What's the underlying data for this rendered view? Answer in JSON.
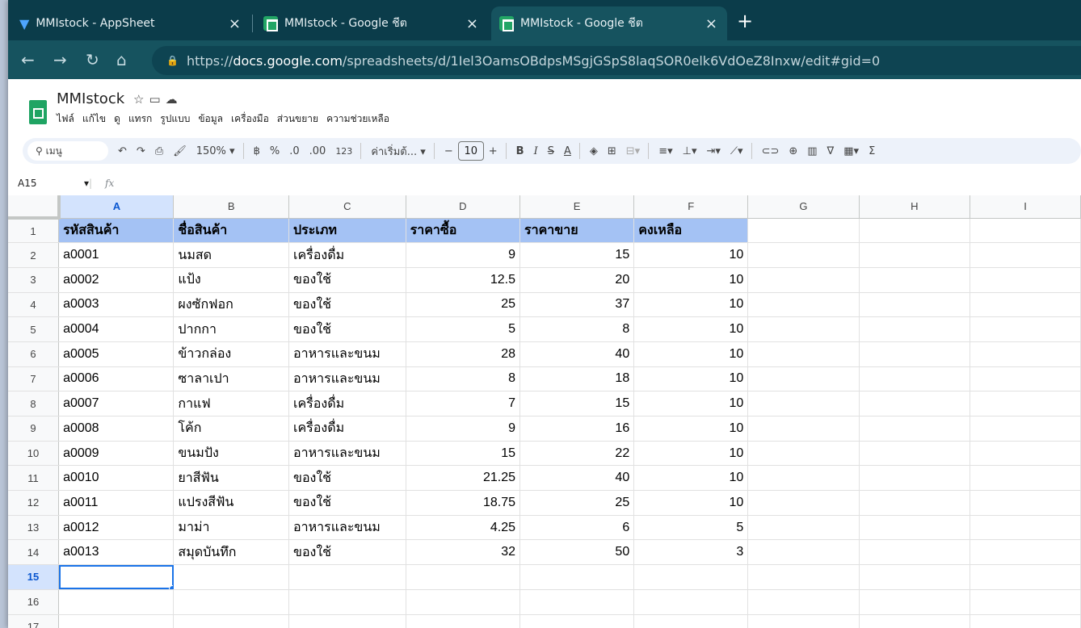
{
  "browser": {
    "tabs": [
      {
        "title": "MMIstock - AppSheet",
        "active": false
      },
      {
        "title": "MMIstock - Google ชีต",
        "active": false
      },
      {
        "title": "MMIstock - Google ชีต",
        "active": true
      }
    ],
    "url_scheme": "https://",
    "url_host": "docs.google.com",
    "url_path": "/spreadsheets/d/1Iel3OamsOBdpsMSgjGSpS8laqSOR0elk6VdOeZ8Inxw/edit#gid=0"
  },
  "doc": {
    "title": "MMIstock",
    "menu": [
      "ไฟล์",
      "แก้ไข",
      "ดู",
      "แทรก",
      "รูปแบบ",
      "ข้อมูล",
      "เครื่องมือ",
      "ส่วนขยาย",
      "ความช่วยเหลือ"
    ]
  },
  "toolbar": {
    "search_label": "เมนู",
    "zoom": "150%",
    "currency": "฿",
    "percent": "%",
    "dec_decrease": ".0",
    "dec_increase": ".00",
    "number_format": "123",
    "font": "ค่าเริ่มต้...",
    "font_size": "10",
    "minus": "−",
    "plus": "+",
    "bold": "B",
    "italic": "I",
    "text_color": "A"
  },
  "formula_bar": {
    "cell_ref": "A15",
    "fx": "fx"
  },
  "grid": {
    "columns": [
      "A",
      "B",
      "C",
      "D",
      "E",
      "F",
      "G",
      "H",
      "I"
    ],
    "header_row": [
      "รหัสสินค้า",
      "ชื่อสินค้า",
      "ประเภท",
      "ราคาซื้อ",
      "ราคาขาย",
      "คงเหลือ"
    ],
    "rows": [
      [
        "a0001",
        "นมสด",
        "เครื่องดื่ม",
        "9",
        "15",
        "10"
      ],
      [
        "a0002",
        "แป้ง",
        "ของใช้",
        "12.5",
        "20",
        "10"
      ],
      [
        "a0003",
        "ผงซักฟอก",
        "ของใช้",
        "25",
        "37",
        "10"
      ],
      [
        "a0004",
        "ปากกา",
        "ของใช้",
        "5",
        "8",
        "10"
      ],
      [
        "a0005",
        "ข้าวกล่อง",
        "อาหารและขนม",
        "28",
        "40",
        "10"
      ],
      [
        "a0006",
        "ซาลาเปา",
        "อาหารและขนม",
        "8",
        "18",
        "10"
      ],
      [
        "a0007",
        "กาแฟ",
        "เครื่องดื่ม",
        "7",
        "15",
        "10"
      ],
      [
        "a0008",
        "โค้ก",
        "เครื่องดื่ม",
        "9",
        "16",
        "10"
      ],
      [
        "a0009",
        "ขนมปัง",
        "อาหารและขนม",
        "15",
        "22",
        "10"
      ],
      [
        "a0010",
        "ยาสีฟัน",
        "ของใช้",
        "21.25",
        "40",
        "10"
      ],
      [
        "a0011",
        "แปรงสีฟัน",
        "ของใช้",
        "18.75",
        "25",
        "10"
      ],
      [
        "a0012",
        "มาม่า",
        "อาหารและขนม",
        "4.25",
        "6",
        "5"
      ],
      [
        "a0013",
        "สมุดบันทึก",
        "ของใช้",
        "32",
        "50",
        "3"
      ]
    ],
    "row_numbers": [
      "1",
      "2",
      "3",
      "4",
      "5",
      "6",
      "7",
      "8",
      "9",
      "10",
      "11",
      "12",
      "13",
      "14",
      "15",
      "16",
      "17"
    ],
    "selected_cell": "A15"
  }
}
